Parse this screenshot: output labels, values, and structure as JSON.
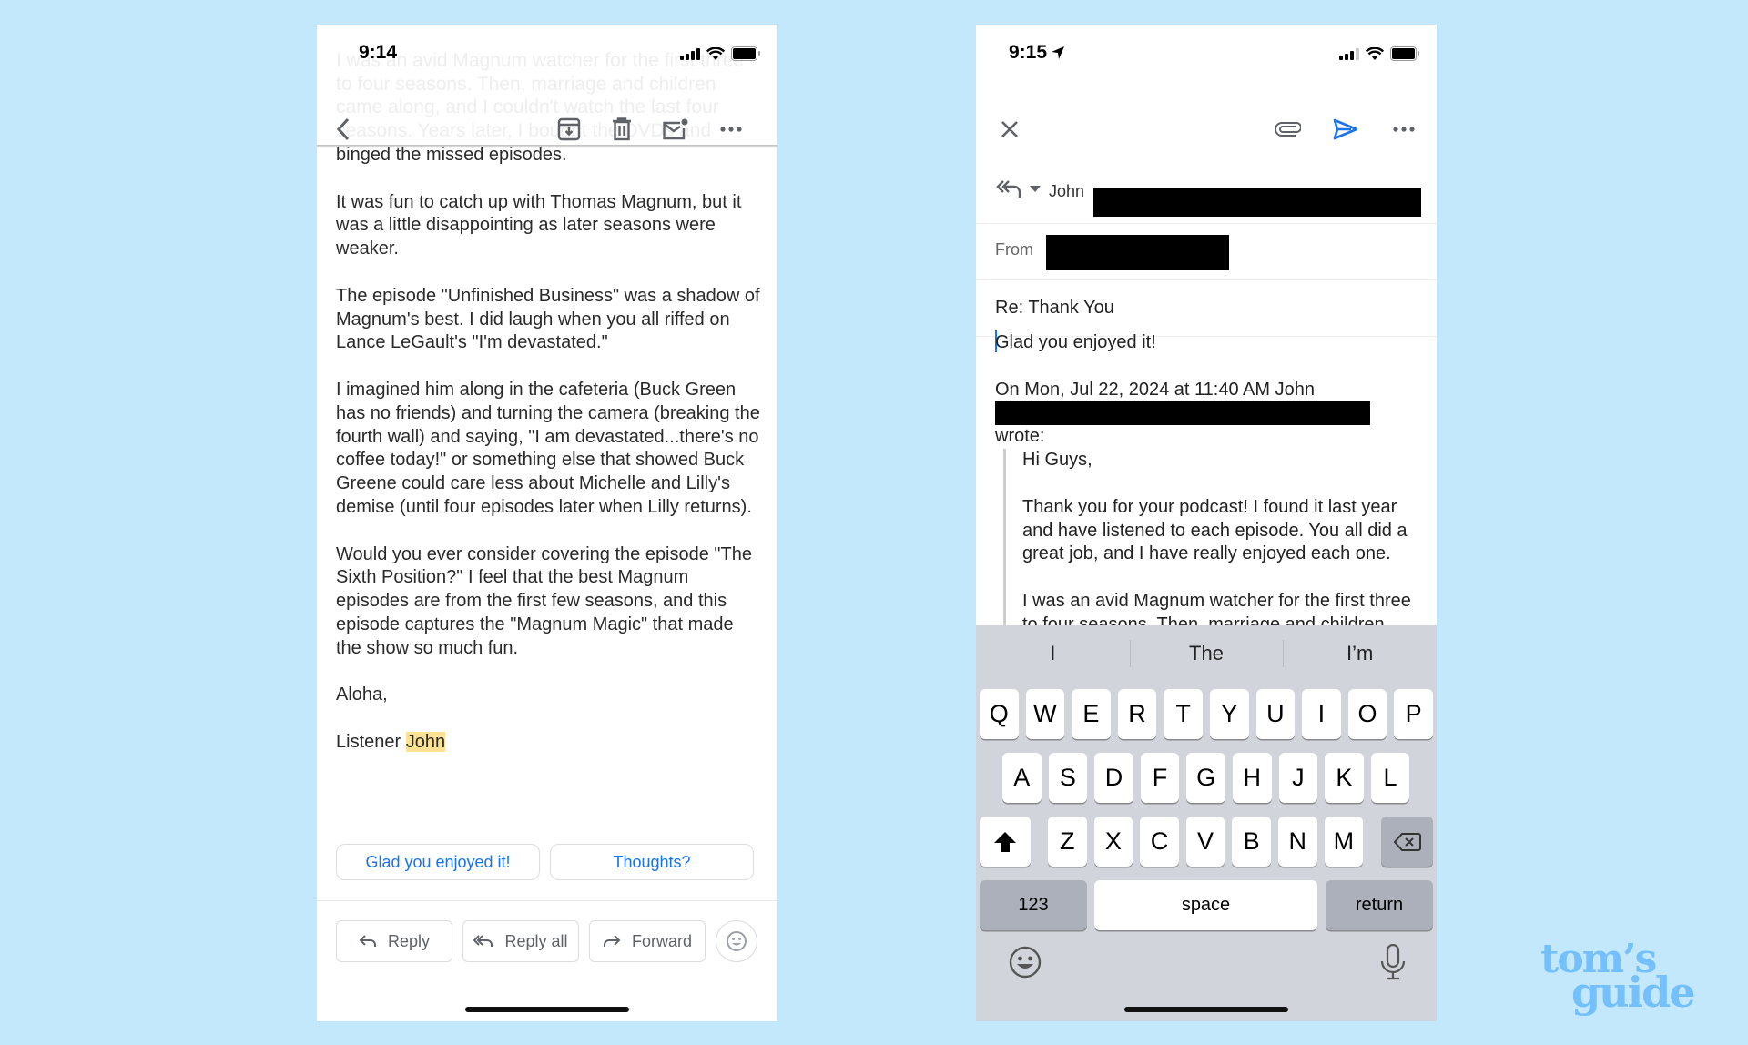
{
  "left_screen": {
    "status_time": "9:14",
    "faded_text": "I was an avid Magnum watcher for the first three to four seasons. Then, marriage and children came along, and I couldn't watch the last four seasons. Years later, I bought the DVDs and",
    "paragraphs": [
      "binged the missed episodes.",
      "It was fun to catch up with Thomas Magnum, but it was a little disappointing as later seasons were weaker.",
      "The episode \"Unfinished Business\" was a shadow of Magnum's best.  I did laugh when you all riffed on Lance LeGault's \"I'm devastated.\"",
      "I imagined him along in the cafeteria (Buck Green has no friends) and turning the camera (breaking the fourth wall) and saying, \"I am devastated...there's no coffee today!\" or something else that showed Buck Greene could care less about Michelle and Lilly's demise (until four episodes later when Lilly returns).",
      "Would you ever consider covering the episode \"The Sixth Position?\"  I feel that the best Magnum episodes are from the first few seasons, and this episode captures the \"Magnum Magic\" that made the show so much fun.",
      "Aloha,"
    ],
    "signature_prefix": "Listener ",
    "signature_name": "John",
    "smart_replies": [
      "Glad you enjoyed it!",
      "Thoughts?"
    ],
    "actions": {
      "reply": "Reply",
      "reply_all": "Reply all",
      "forward": "Forward"
    }
  },
  "right_screen": {
    "status_time": "9:15",
    "to_name": "John",
    "from_label": "From",
    "subject": "Re: Thank You",
    "compose_text": "Glad you enjoyed it!",
    "quote_header": "On Mon, Jul 22, 2024 at 11:40 AM John",
    "quote_wrote": "wrote:",
    "quoted": [
      "Hi Guys,",
      "Thank you for your podcast! I found it last year and have listened to each episode. You all did a great job, and I have really enjoyed each one.",
      "I was an avid Magnum watcher for the first three to four seasons. Then, marriage and children"
    ],
    "suggestions": [
      "I",
      "The",
      "I’m"
    ],
    "keyboard": {
      "row1": [
        "Q",
        "W",
        "E",
        "R",
        "T",
        "Y",
        "U",
        "I",
        "O",
        "P"
      ],
      "row2": [
        "A",
        "S",
        "D",
        "F",
        "G",
        "H",
        "J",
        "K",
        "L"
      ],
      "row3": [
        "Z",
        "X",
        "C",
        "V",
        "B",
        "N",
        "M"
      ],
      "numbers": "123",
      "space": "space",
      "return": "return"
    }
  },
  "watermark": {
    "line1": "tom’s",
    "line2": "guide"
  },
  "colors": {
    "background": "#c3e8fb",
    "accent": "#1a73e8",
    "highlight": "#fde293",
    "keyboard": "#d1d4da"
  }
}
